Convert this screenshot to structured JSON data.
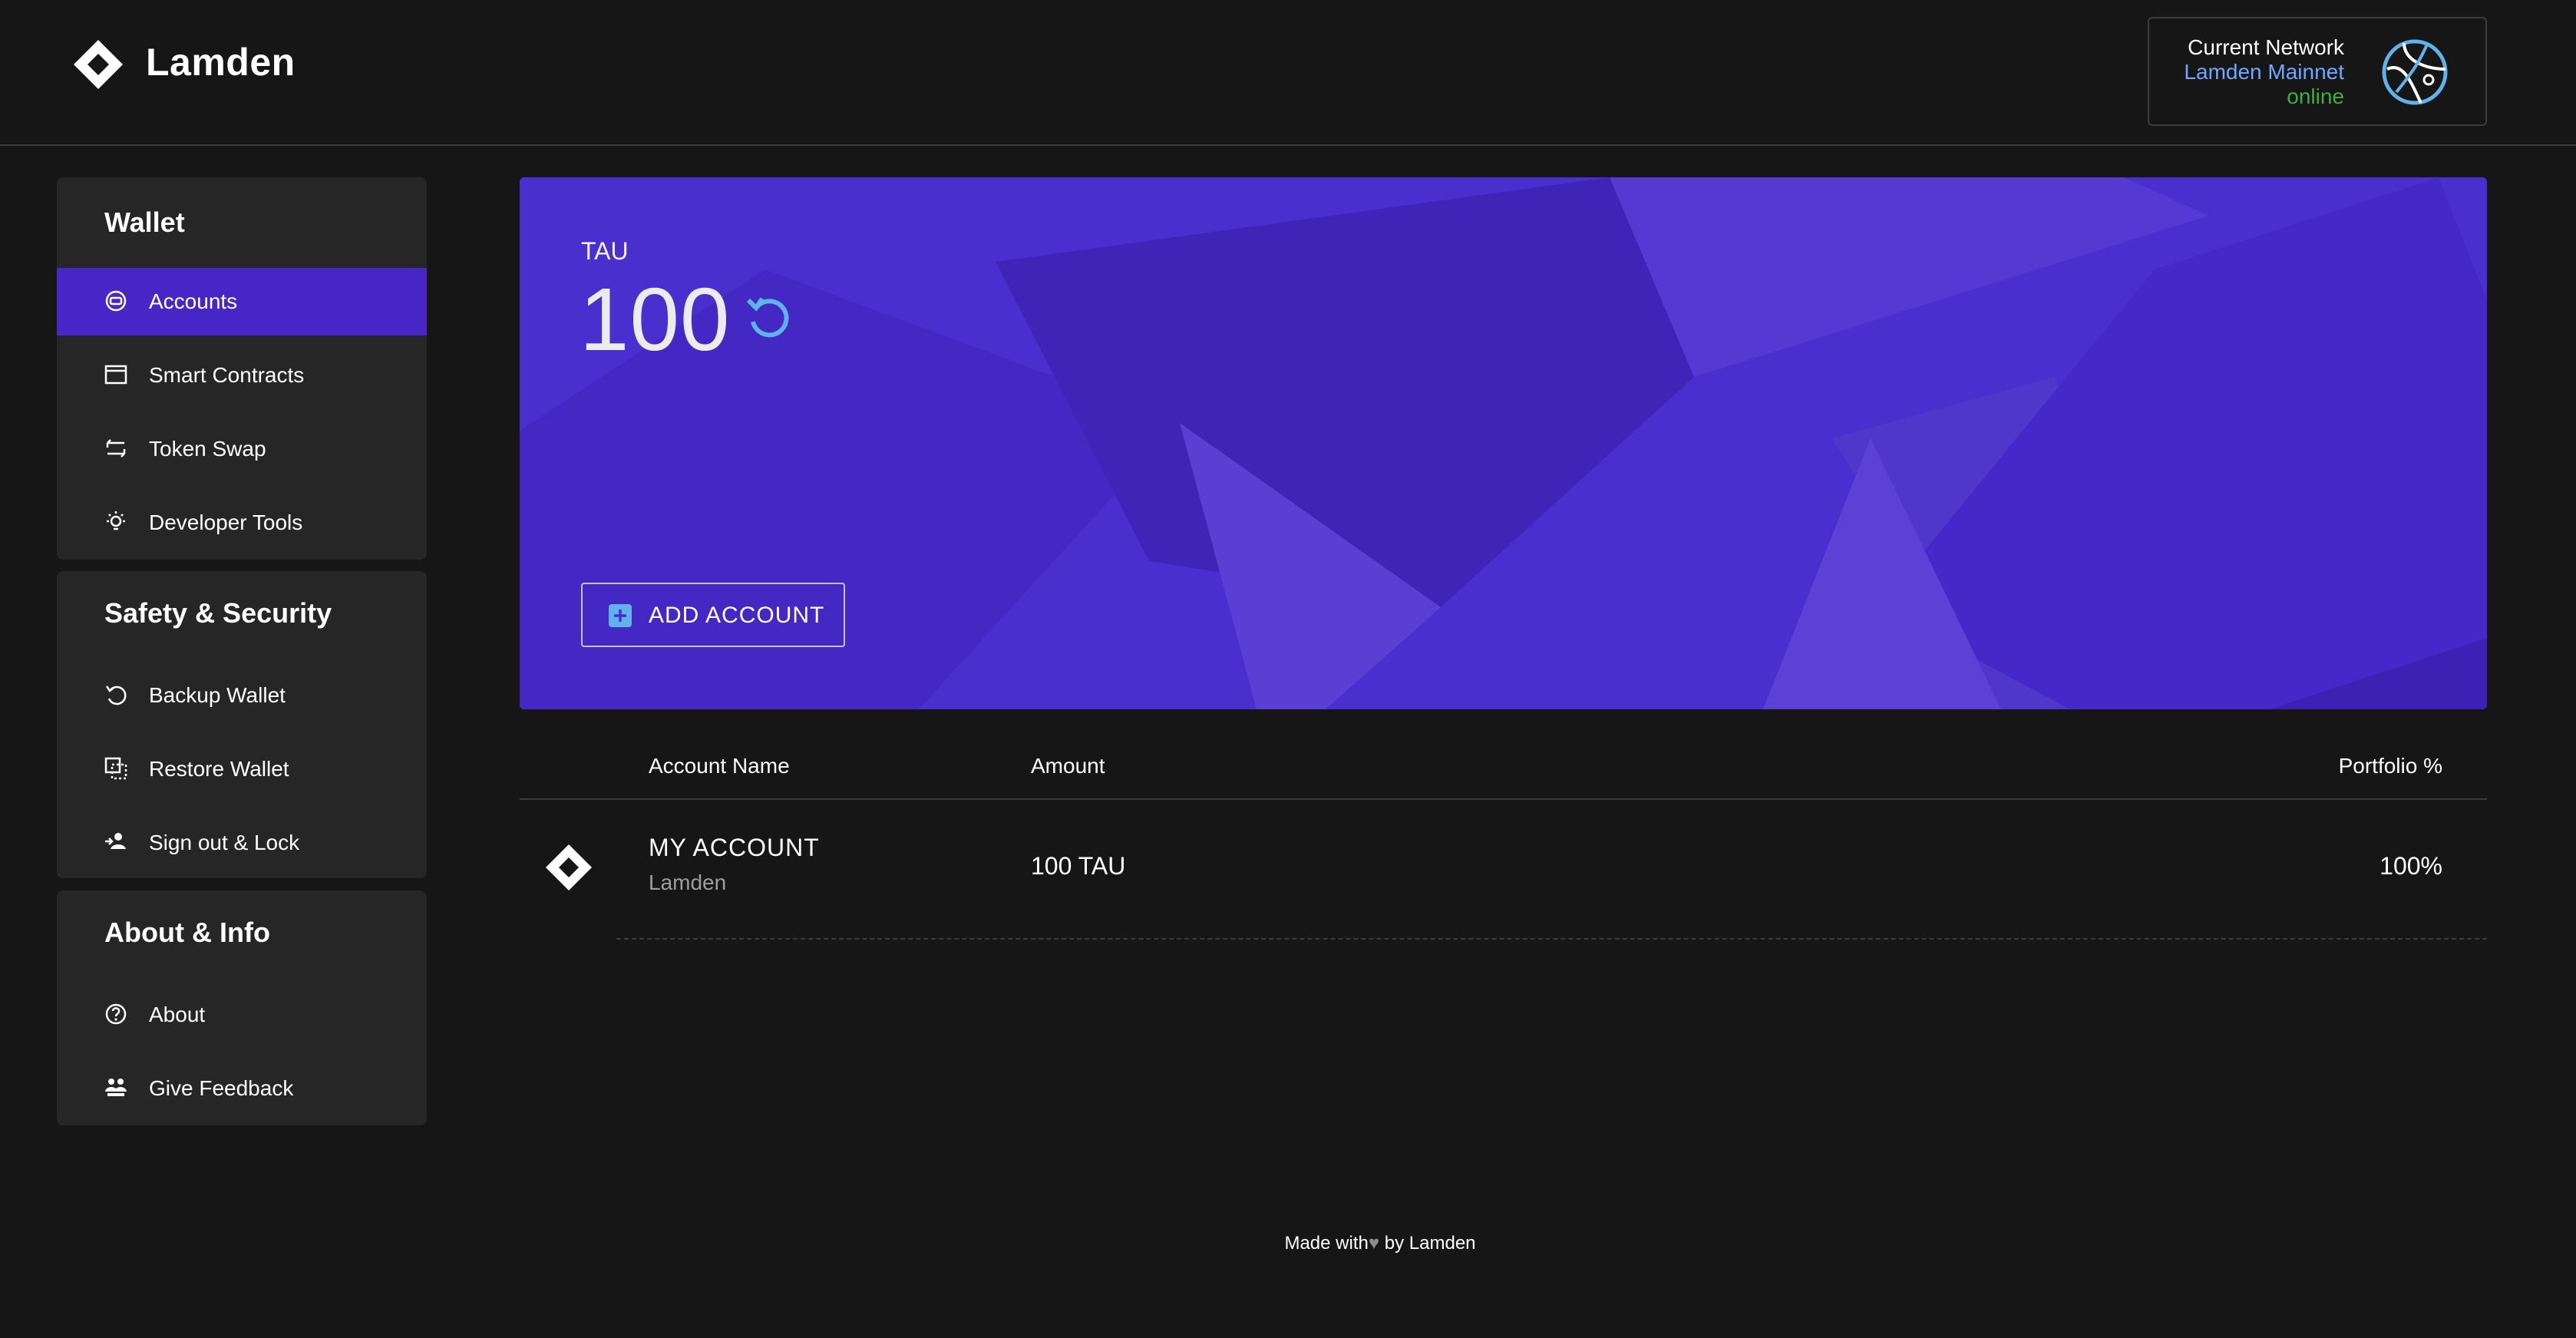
{
  "header": {
    "app_title": "Lamden",
    "network": {
      "label": "Current Network",
      "name": "Lamden Mainnet",
      "status": "online"
    }
  },
  "sidebar": {
    "wallet": {
      "title": "Wallet",
      "items": [
        {
          "label": "Accounts",
          "icon": "accounts-icon",
          "active": true
        },
        {
          "label": "Smart Contracts",
          "icon": "smart-contracts-icon"
        },
        {
          "label": "Token Swap",
          "icon": "swap-icon"
        },
        {
          "label": "Developer Tools",
          "icon": "lightbulb-icon"
        }
      ]
    },
    "security": {
      "title": "Safety & Security",
      "items": [
        {
          "label": "Backup Wallet",
          "icon": "backup-icon"
        },
        {
          "label": "Restore Wallet",
          "icon": "restore-icon"
        },
        {
          "label": "Sign out & Lock",
          "icon": "sign-out-icon"
        }
      ]
    },
    "about": {
      "title": "About & Info",
      "items": [
        {
          "label": "About",
          "icon": "help-icon"
        },
        {
          "label": "Give Feedback",
          "icon": "feedback-icon"
        }
      ]
    }
  },
  "hero": {
    "currency": "TAU",
    "balance": "100",
    "add_account_label": "ADD ACCOUNT"
  },
  "table": {
    "columns": [
      "Account Name",
      "Amount",
      "Portfolio %"
    ],
    "rows": [
      {
        "name": "MY ACCOUNT",
        "sub": "Lamden",
        "amount": "100 TAU",
        "portfolio": "100%"
      }
    ]
  },
  "footer": {
    "made_with": "Made with",
    "by": "by Lamden"
  },
  "colors": {
    "accent": "#4626c7",
    "hero": "#4b2fd1",
    "network_name": "#6fa8ff",
    "online": "#3fae3f"
  }
}
